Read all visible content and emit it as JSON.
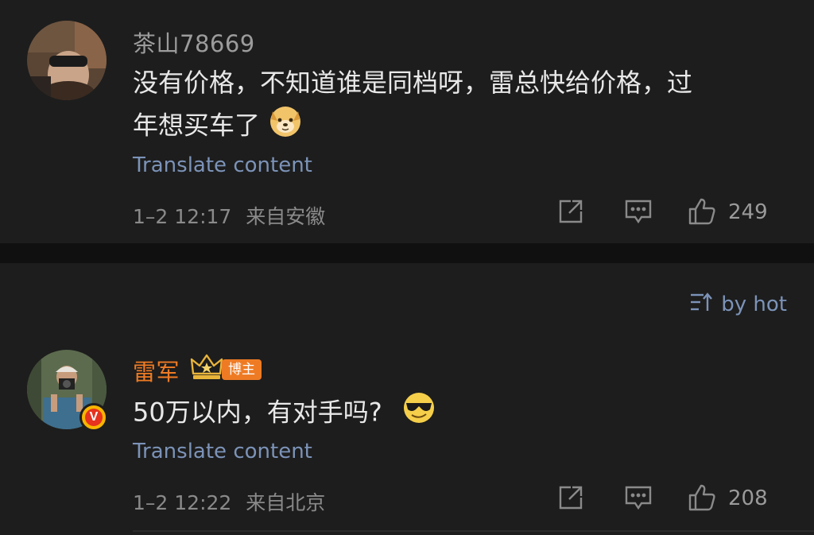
{
  "comments": [
    {
      "username": "茶山78669",
      "text_line1": "没有价格，不知道谁是同档呀，雷总快给价格，过",
      "text_line2": "年想买车了",
      "emoji": "doge-emoji",
      "translate": "Translate content",
      "timestamp": "1–2 12:17",
      "location": "来自安徽",
      "likes": "249"
    },
    {
      "username": "雷军",
      "badge": "博主",
      "text": "50万以内，有对手吗?",
      "emoji": "sunglasses-emoji",
      "translate": "Translate content",
      "timestamp": "1–2 12:22",
      "location": "来自北京",
      "likes": "208"
    }
  ],
  "sort": {
    "label": "by hot"
  },
  "colors": {
    "author": "#ee7b24",
    "link": "#7c93b8",
    "background": "#1d1d1d"
  }
}
